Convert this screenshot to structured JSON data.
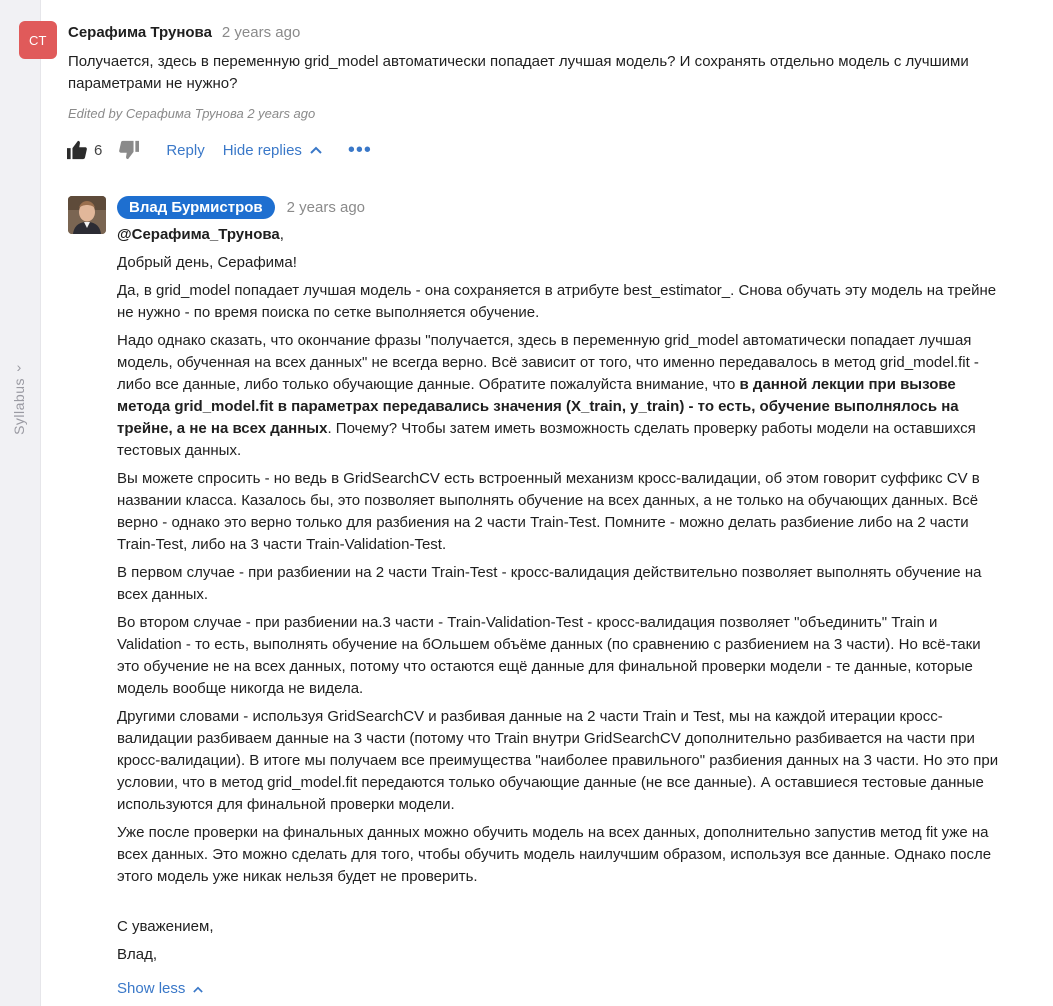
{
  "sidebar": {
    "syllabus_label": "Syllabus"
  },
  "comment": {
    "avatar_initials": "СТ",
    "author": "Серафима Трунова",
    "time": "2 years ago",
    "body": "Получается, здесь в переменную grid_model автоматически попадает лучшая модель? И сохранять отдельно модель с лучшими параметрами не нужно?",
    "edited_prefix": "Edited by",
    "edited_author": "Серафима Трунова",
    "edited_time": "2 years ago",
    "like_count": "6",
    "reply_label": "Reply",
    "hide_replies_label": "Hide replies",
    "more_label": "•••"
  },
  "reply": {
    "author": "Влад Бурмистров",
    "time": "2 years ago",
    "mention": "@Серафима_Трунова",
    "mention_suffix": ",",
    "greeting": "Добрый день, Серафима!",
    "p1": "Да, в grid_model попадает лучшая модель - она сохраняется в атрибуте best_estimator_. Снова обучать эту модель на трейне не нужно - по время поиска по сетке выполняется обучение.",
    "p2_start": "Надо однако сказать, что окончание фразы \"получается, здесь в переменную grid_model автоматически попадает лучшая модель, обученная на всех данных\" не всегда верно. Всё зависит от того, что именно передавалось в метод grid_model.fit - либо все данные, либо только обучающие данные. Обратите пожалуйста внимание, что ",
    "p2_bold": "в данной лекции при вызове метода grid_model.fit в параметрах передавались значения (X_train, y_train) - то есть, обучение выполнялось на трейне, а не на всех данных",
    "p2_end": ". Почему? Чтобы затем иметь возможность сделать проверку работы модели на оставшихся тестовых данных.",
    "p3": "Вы можете спросить - но ведь в GridSearchCV есть встроенный механизм кросс-валидации, об этом говорит суффикс CV в названии класса. Казалось бы,  это позволяет выполнять обучение на всех данных, а не только на обучающих данных. Всё верно - однако это верно только для разбиения на 2 части Train-Test. Помните - можно делать разбиение либо на 2 части Train-Test, либо на 3 части Train-Validation-Test.",
    "p4": "В первом случае - при разбиении на 2 части Train-Test - кросс-валидация действительно позволяет выполнять обучение на всех данных.",
    "p5": "Во втором случае - при разбиении на.3 части - Train-Validation-Test - кросс-валидация позволяет \"объединить\" Train и Validation - то есть, выполнять обучение на бОльшем объёме данных (по сравнению с разбиением на 3 части). Но всё-таки это обучение не на всех данных, потому что остаются ещё данные для финальной проверки модели - те данные, которые модель вообще никогда не видела.",
    "p6": "Другими словами - используя GridSearchCV и разбивая данные на 2 части Train и Test, мы на каждой итерации кросс-валидации разбиваем данные на 3 части (потому что Train внутри GridSearchCV дополнительно разбивается на части при кросс-валидации). В итоге мы получаем все преимущества \"наиболее правильного\" разбиения данных на 3 части. Но это при условии, что в метод grid_model.fit передаются только обучающие данные (не все данные). А оставшиеся тестовые данные используются для финальной проверки модели.",
    "p7": "Уже после проверки на финальных данных можно обучить модель на всех данных, дополнительно запустив метод fit уже на всех данных. Это можно сделать для того, чтобы обучить модель наилучшим образом, используя все данные. Однако после этого модель уже никак нельзя будет не проверить.",
    "signoff": "С уважением,",
    "signature": "Влад,",
    "show_less_label": "Show less"
  }
}
